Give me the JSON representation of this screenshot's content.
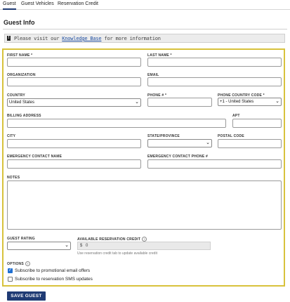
{
  "tabs": [
    {
      "label": "Guest"
    },
    {
      "label": "Guest Vehicles"
    },
    {
      "label": "Reservation Credit"
    }
  ],
  "section_title": "Guest Info",
  "info_banner": {
    "icon": "exclamation-icon",
    "prefix": "Please visit our ",
    "link": "Knowledge Base",
    "suffix": " for more information"
  },
  "fields": {
    "first_name": {
      "label": "FIRST NAME *",
      "value": ""
    },
    "last_name": {
      "label": "LAST NAME *",
      "value": ""
    },
    "organization": {
      "label": "ORGANIZATION",
      "value": ""
    },
    "email": {
      "label": "EMAIL",
      "value": ""
    },
    "country": {
      "label": "COUNTRY",
      "value": "United States"
    },
    "phone": {
      "label": "PHONE # *",
      "value": ""
    },
    "phone_country_code": {
      "label": "PHONE COUNTRY CODE *",
      "value": "+1 - United States"
    },
    "billing_address": {
      "label": "BILLING ADDRESS",
      "value": ""
    },
    "apt": {
      "label": "APT",
      "value": ""
    },
    "city": {
      "label": "CITY",
      "value": ""
    },
    "state": {
      "label": "STATE/PROVINCE",
      "value": ""
    },
    "postal_code": {
      "label": "POSTAL CODE",
      "value": ""
    },
    "emergency_name": {
      "label": "EMERGENCY CONTACT NAME",
      "value": ""
    },
    "emergency_phone": {
      "label": "EMERGENCY CONTACT PHONE #",
      "value": ""
    },
    "notes": {
      "label": "NOTES",
      "value": ""
    },
    "guest_rating": {
      "label": "GUEST RATING",
      "value": ""
    },
    "available_credit": {
      "label": "AVAILABLE RESERVATION CREDIT",
      "currency": "$",
      "value": "0",
      "hint": "Use reservation credit tab to update available credit"
    }
  },
  "options": {
    "label": "OPTIONS",
    "items": [
      {
        "label": "Subscribe to promotional email offers",
        "checked": true
      },
      {
        "label": "Subscribe to reservation SMS updates",
        "checked": false
      }
    ]
  },
  "save_button": "SAVE GUEST",
  "colors": {
    "accent": "#1f3b74",
    "highlight_border": "#d8c23c",
    "checkbox": "#1f6fd1"
  }
}
